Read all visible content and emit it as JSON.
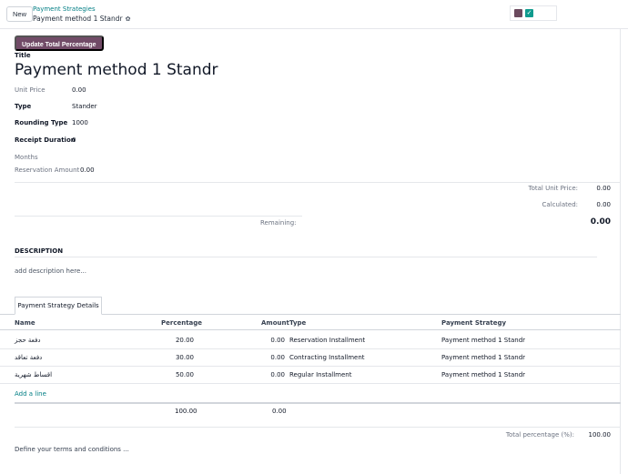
{
  "topbar": {
    "new_label": "New",
    "breadcrumb_parent": "Payment Strategies",
    "breadcrumb_current": "Payment method 1 Standr",
    "status_check": "✓"
  },
  "form": {
    "update_button": "Update Total Percentage",
    "title_label": "Title",
    "title_value": "Payment method 1 Standr",
    "fields": {
      "unit_price_label": "Unit Price",
      "unit_price_value": "0.00",
      "type_label": "Type",
      "type_value": "Stander",
      "rounding_label": "Rounding Type",
      "rounding_value": "1000",
      "receipt_label": "Receipt Duration",
      "receipt_value": "0",
      "months_label": "Months",
      "reservation_label": "Reservation Amount",
      "reservation_value": "0.00"
    },
    "totals": {
      "total_unit_price_label": "Total Unit Price:",
      "total_unit_price_value": "0.00",
      "calculated_label": "Calculated:",
      "calculated_value": "0.00",
      "remaining_label": "Remaining:",
      "remaining_value": "0.00"
    },
    "description_label": "DESCRIPTION",
    "description_placeholder": "add description here..."
  },
  "tabs": [
    {
      "label": "Payment Strategy Details"
    }
  ],
  "table": {
    "headers": {
      "name": "Name",
      "percentage": "Percentage",
      "amount": "Amount",
      "type": "Type",
      "strategy": "Payment Strategy"
    },
    "rows": [
      {
        "name": "دفعة حجز",
        "percentage": "20.00",
        "amount": "0.00",
        "type": "Reservation Installment",
        "strategy": "Payment method 1 Standr"
      },
      {
        "name": "دفعة تعاقد",
        "percentage": "30.00",
        "amount": "0.00",
        "type": "Contracting Installment",
        "strategy": "Payment method 1 Standr"
      },
      {
        "name": "اقساط شهرية",
        "percentage": "50.00",
        "amount": "0.00",
        "type": "Regular Installment",
        "strategy": "Payment method 1 Standr"
      }
    ],
    "add_line": "Add a line",
    "footer_percentage": "100.00",
    "footer_amount": "0.00"
  },
  "summary": {
    "total_percentage_label": "Total percentage (%):",
    "total_percentage_value": "100.00"
  },
  "terms_placeholder": "Define your terms and conditions ..."
}
